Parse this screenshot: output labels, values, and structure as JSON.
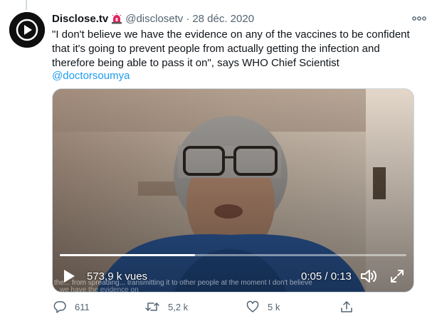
{
  "tweet": {
    "display_name": "Disclose.tv",
    "handle": "@disclosetv",
    "separator": "·",
    "date": "28 déc. 2020",
    "text": "\"I don't believe we have the evidence on any of the vaccines to be confident that it's going to prevent people from actually getting the infection and therefore being able to pass it on\", says WHO Chief Scientist",
    "mention": "@doctorsoumya",
    "icons": {
      "avatar": "disclose-play-logo",
      "badge": "siren-icon",
      "more": "more-icon"
    }
  },
  "video": {
    "views": "573,9 k vues",
    "time": "0:05 / 0:13",
    "progress": 0.39,
    "subtitle_line_1": "the... from spreading... transmitting it to other people at the moment I don't believe",
    "subtitle_line_2": "we have the evidence on",
    "icons": {
      "play": "play-icon",
      "volume": "volume-icon",
      "fullscreen": "fullscreen-icon"
    }
  },
  "actions": {
    "reply_count": "611",
    "retweet_count": "5,2 k",
    "like_count": "5 k",
    "icons": {
      "reply": "reply-icon",
      "retweet": "retweet-icon",
      "like": "heart-icon",
      "share": "share-icon"
    }
  },
  "colors": {
    "accent": "#1d9bf0",
    "text": "#0f1419",
    "secondary": "#536471",
    "border": "#cfd9de"
  }
}
